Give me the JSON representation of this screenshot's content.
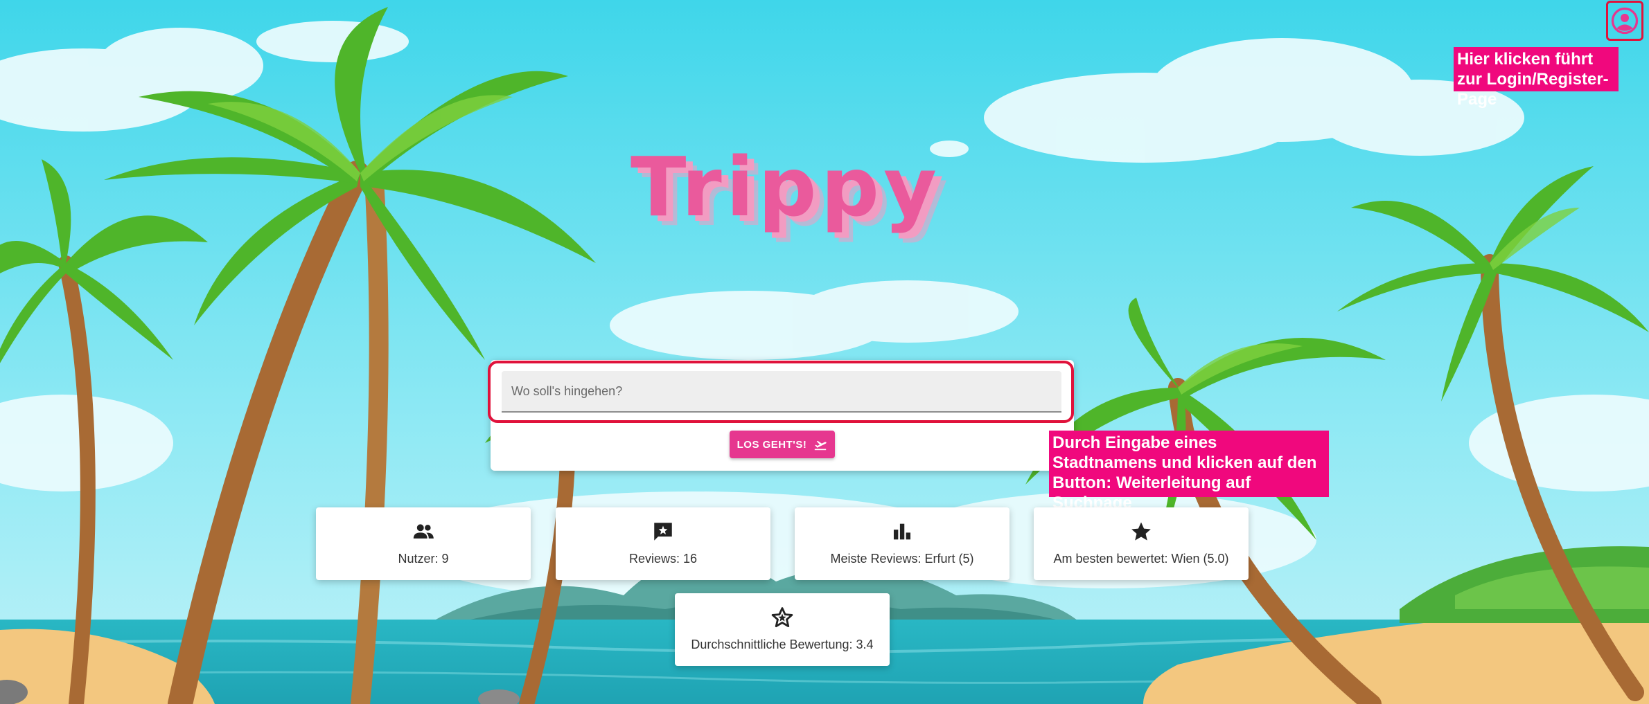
{
  "app": {
    "logo_text": "Trippy",
    "colors": {
      "accent": "#e6378f",
      "annotation": "#f0087d",
      "highlight": "#e0123b"
    }
  },
  "profile": {
    "icon": "account-circle-icon",
    "annotation": "Hier klicken führt zur Login/Register-Page"
  },
  "search": {
    "placeholder": "Wo soll's hingehen?",
    "value": "",
    "button_label": "LOS GEHT'S!",
    "button_icon": "flight-takeoff-icon",
    "annotation": "Durch Eingabe eines Stadtnamens und klicken auf den Button: Weiterleitung auf Suchpage"
  },
  "stats": [
    {
      "icon": "people-icon",
      "label": "Nutzer: 9"
    },
    {
      "icon": "reviews-icon",
      "label": "Reviews: 16"
    },
    {
      "icon": "bar-chart-icon",
      "label": "Meiste Reviews: Erfurt (5)"
    },
    {
      "icon": "star-icon",
      "label": "Am besten bewertet: Wien (5.0)"
    },
    {
      "icon": "star-outline-icon",
      "label": "Durchschnittliche Bewertung: 3.4"
    }
  ]
}
